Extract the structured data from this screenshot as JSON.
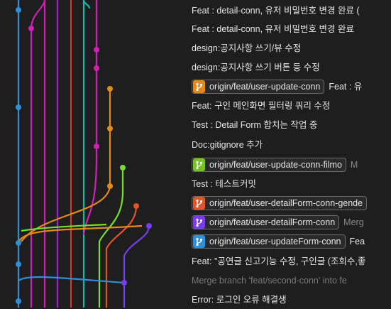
{
  "colors": {
    "background": "#1e1e1e",
    "lane_blue": "#2f8fd8",
    "lane_magenta": "#d21fb8",
    "lane_purple": "#a21fe0",
    "lane_red": "#e8332c",
    "lane_teal": "#16b8a8",
    "lane_orange": "#e48a1a",
    "lane_lime": "#76e02a",
    "lane_violet": "#7a3cf0"
  },
  "commits": [
    {
      "message": "Feat : detail-conn, 유저 비밀번호 변경 완료 (",
      "dim": false
    },
    {
      "message": "Feat : detail-conn, 유저 비밀번호 변경 완료",
      "dim": false
    },
    {
      "message": "design:공지사항 쓰기/뷰 수정",
      "dim": false
    },
    {
      "message": "design:공지사항 쓰기 버튼 등 수정",
      "dim": false
    },
    {
      "badge": "origin/feat/user-update-conn",
      "badge_color": "#e48a1a",
      "badge_icon": "branch-icon",
      "message": "Feat : 유",
      "dim": false
    },
    {
      "message": "Feat: 구인 메인화면 필터링 쿼리 수정",
      "dim": false
    },
    {
      "message": "Test : Detail Form 합치는 작업 중",
      "dim": false
    },
    {
      "message": "Doc:gitignore 추가",
      "dim": false
    },
    {
      "badge": "origin/feat/user-update-conn-filmo",
      "badge_color": "#76c22a",
      "badge_icon": "branch-icon",
      "message": "M",
      "dim": true
    },
    {
      "message": "Test : 테스트커밋",
      "dim": false
    },
    {
      "badge": "origin/feat/user-detailForm-conn-gende",
      "badge_color": "#e0552a",
      "badge_icon": "branch-icon",
      "message": "",
      "dim": false
    },
    {
      "badge": "origin/feat/user-detailForm-conn",
      "badge_color": "#7a3cf0",
      "badge_icon": "branch-icon",
      "message": "Merg",
      "dim": true
    },
    {
      "badge": "origin/feat/user-updateForm-conn",
      "badge_color": "#2f8fd8",
      "badge_icon": "branch-icon",
      "message": "Fea",
      "dim": false
    },
    {
      "message": "Feat: \"공연글 신고기능 수정, 구인글 (조회수,좋",
      "dim": false
    },
    {
      "message": "Merge branch 'feat/second-conn' into fe",
      "dim": true
    },
    {
      "message": "Error: 로그인 오류 해결생",
      "dim": false
    }
  ]
}
